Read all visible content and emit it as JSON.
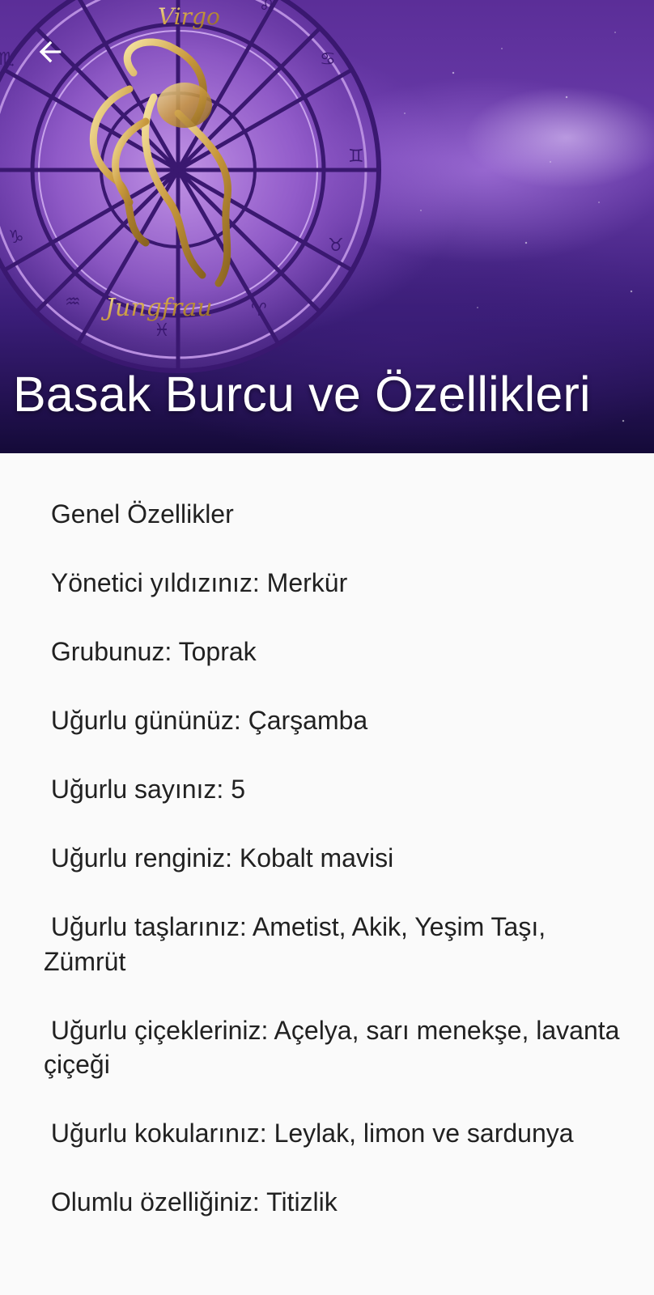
{
  "header": {
    "title": "Basak Burcu ve Özellikleri",
    "back_icon": "arrow-back-icon",
    "image_label_top": "Virgo",
    "image_label_bottom": "Jungfrau"
  },
  "content": {
    "text": " Genel Özellikler\n\n Yönetici yıldızınız: Merkür\n\n Grubunuz: Toprak\n\n Uğurlu gününüz: Çarşamba\n\n Uğurlu sayınız: 5\n\n Uğurlu renginiz: Kobalt mavisi\n\n Uğurlu taşlarınız: Ametist, Akik, Yeşim Taşı, Zümrüt\n\n Uğurlu çiçekleriniz: Açelya, sarı menekşe, lavanta çiçeği\n\n Uğurlu kokularınız: Leylak, limon ve sardunya\n\n Olumlu özelliğiniz: Titizlik"
  },
  "colors": {
    "header_purple": "#5b2e98",
    "zodiac_gold": "#d8b25a",
    "text": "#212121",
    "background": "#fafafa"
  }
}
